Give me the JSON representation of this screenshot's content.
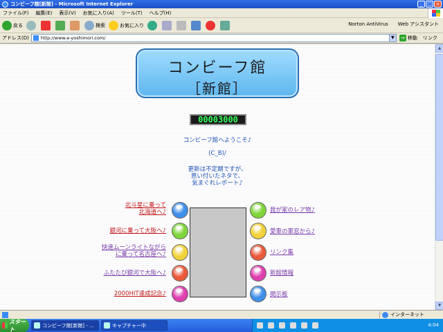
{
  "window": {
    "title": "コンビーフ館[新館] - Microsoft Internet Explorer",
    "min": "_",
    "max": "□",
    "close": "×"
  },
  "menu": [
    "ファイル(F)",
    "編集(E)",
    "表示(V)",
    "お気に入り(A)",
    "ツール(T)",
    "ヘルプ(H)"
  ],
  "toolbar": {
    "back": "戻る",
    "search": "検索",
    "favorites": "お気に入り",
    "norton": "Norton AntiVirus",
    "web_assistant": "Web アシスタント"
  },
  "address": {
    "label": "アドレス(D)",
    "url": "http://www.e-yoshimori.com/",
    "go": "移動",
    "links": "リンク"
  },
  "page": {
    "logo_line1": "コンビーフ館",
    "logo_line2": "［新館］",
    "counter": "00003000",
    "welcome": "コンビーフ館へようこそ♪",
    "face": "(C_B)/",
    "note1": "更新は不定期ですが、",
    "note2": "思い付いたネタで、",
    "note3": "気まぐれレポート♪",
    "left_links": [
      {
        "line1": "北斗星に乗って",
        "line2": "北海道へ♪"
      },
      {
        "line1": "銀河に乗って大阪へ♪",
        "line2": ""
      },
      {
        "line1": "快速ムーンライトながら",
        "line2": "に乗って名古屋へ♪"
      },
      {
        "line1": "ふたたび銀河で大阪へ♪",
        "line2": ""
      },
      {
        "line1": "2000HIT達成記念♪",
        "line2": ""
      }
    ],
    "right_links": [
      "我が家のレア物♪",
      "愛車の車窓から♪",
      "リンク集",
      "新館情報",
      "掲示板"
    ],
    "left_ball_colors": [
      "#3f8fea",
      "#7fd63a",
      "#f2d23a",
      "#ea5a3a",
      "#e03fb0"
    ],
    "right_ball_colors": [
      "#7fd63a",
      "#f2d23a",
      "#ea5a3a",
      "#e03fb0",
      "#3f8fea"
    ]
  },
  "status": {
    "zone": "インターネット"
  },
  "taskbar": {
    "start": "スタート",
    "tasks": [
      "コンビーフ館[新館] - ...",
      "キャプチャー中"
    ],
    "clock": "4:04"
  }
}
